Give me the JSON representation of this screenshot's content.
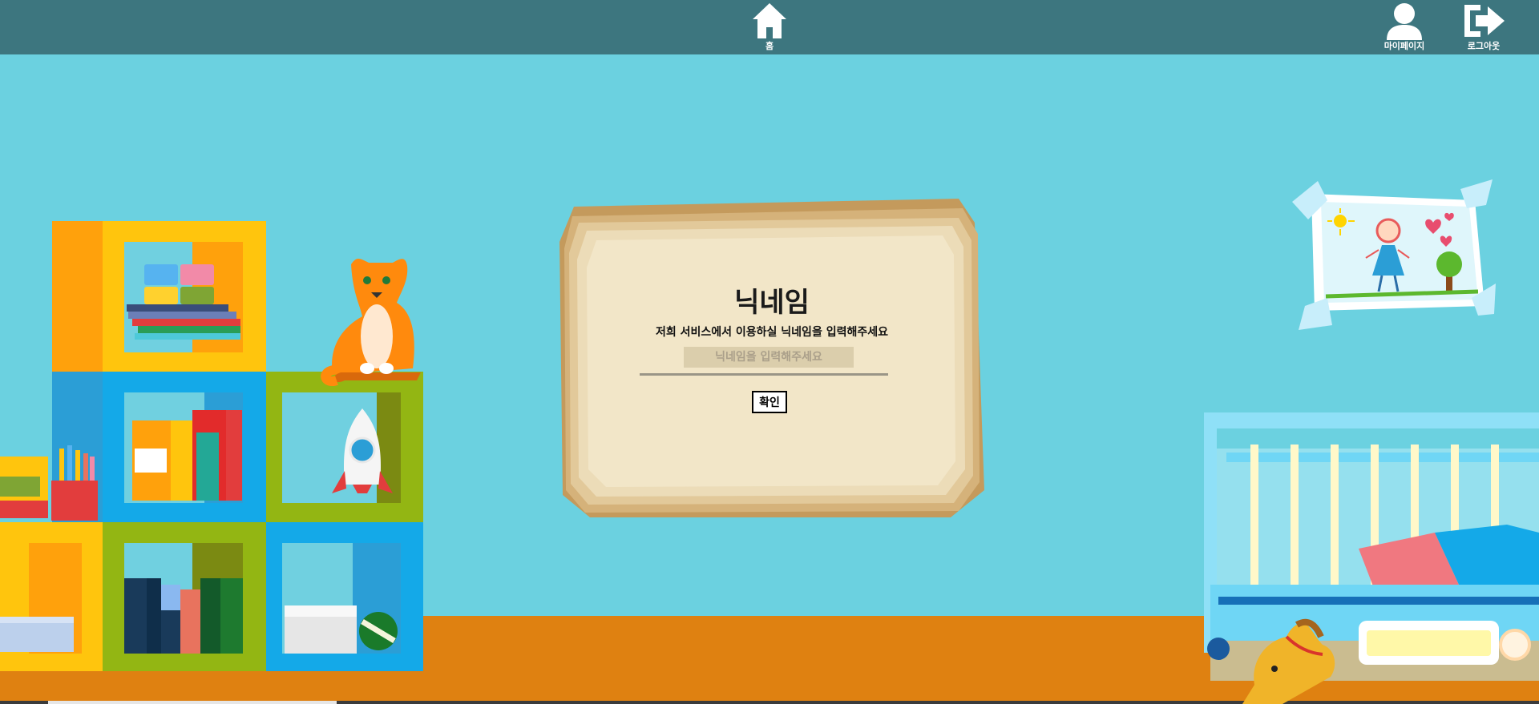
{
  "topbar": {
    "home_label": "홈",
    "mypage_label": "마이페이지",
    "logout_label": "로그아웃"
  },
  "dialog": {
    "title": "닉네임",
    "description": "저희 서비스에서 이용하실 닉네임을 입력해주세요",
    "input_placeholder": "닉네임을 입력해주세요",
    "input_value": "",
    "confirm_label": "확인"
  },
  "colors": {
    "topbar": "#3d767f",
    "background": "#6bd1e0",
    "floor": "#df8111"
  },
  "icons": [
    "home-icon",
    "user-icon",
    "logout-icon"
  ]
}
